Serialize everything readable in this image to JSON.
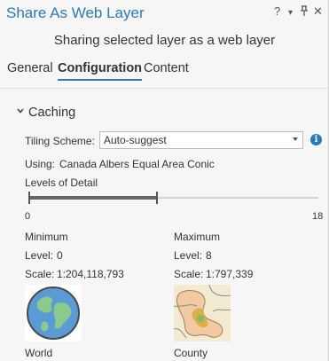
{
  "window": {
    "title": "Share As Web Layer",
    "controls": [
      "?",
      "▾",
      "⫯",
      "✕"
    ]
  },
  "subtitle": "Sharing selected layer as a web layer",
  "tabs": [
    {
      "label": "General",
      "active": false
    },
    {
      "label": "Configuration",
      "active": true
    },
    {
      "label": "Content",
      "active": false
    }
  ],
  "caching": {
    "section_title": "Caching",
    "tiling_scheme_label": "Tiling Scheme:",
    "tiling_scheme_value": "Auto-suggest",
    "using_label": "Using:",
    "using_value": "Canada Albers Equal Area Conic",
    "lod_label": "Levels of Detail",
    "lod_range": {
      "min": 0,
      "max": 18,
      "selected_min": 0,
      "selected_max": 8
    },
    "tick_min": "0",
    "tick_max": "18",
    "minimum": {
      "title": "Minimum",
      "level_label": "Level:",
      "level_value": "0",
      "scale_label": "Scale:",
      "scale_value": "1:204,118,793",
      "name": "World"
    },
    "maximum": {
      "title": "Maximum",
      "level_label": "Level:",
      "level_value": "8",
      "scale_label": "Scale:",
      "scale_value": "1:797,339",
      "name": "County"
    }
  },
  "colors": {
    "accent": "#2a7ab9",
    "range_fill": "#666666",
    "globe_water": "#5b9bd5",
    "globe_land": "#7fbf7f"
  }
}
